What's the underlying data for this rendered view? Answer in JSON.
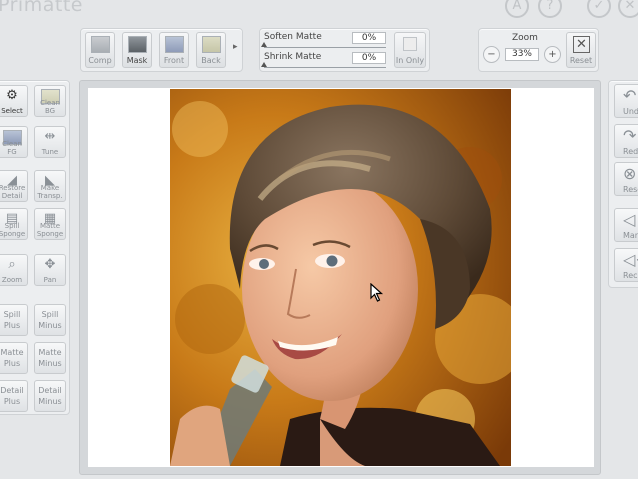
{
  "app": {
    "title": "Primatte",
    "title_buttons": [
      {
        "name": "about",
        "glyph": "A"
      },
      {
        "name": "help",
        "glyph": "?"
      },
      {
        "name": "ok",
        "glyph": "✓"
      },
      {
        "name": "close",
        "glyph": "✕"
      }
    ]
  },
  "view_toolbar": {
    "buttons": [
      {
        "id": "comp",
        "label": "Comp"
      },
      {
        "id": "mask",
        "label": "Mask"
      },
      {
        "id": "front",
        "label": "Front"
      },
      {
        "id": "back",
        "label": "Back"
      }
    ],
    "more_glyph": "▸"
  },
  "matte_controls": {
    "soften_label": "Soften Matte",
    "soften_value": "0%",
    "soften_level": 0.0,
    "shrink_label": "Shrink Matte",
    "shrink_value": "0%",
    "shrink_level": 0.0,
    "in_only_label": "In Only"
  },
  "zoom": {
    "label": "Zoom",
    "minus": "−",
    "value": "33%",
    "plus": "+",
    "reset_label": "Reset"
  },
  "left_tools": [
    {
      "id": "select",
      "label": "Select",
      "icon": "gear-icon",
      "glyph": "⚙",
      "active": true
    },
    {
      "id": "clean-bg",
      "label": "Clean BG",
      "icon": "clean-bg-swatch",
      "glyph": ""
    },
    {
      "id": "clean-fg",
      "label": "Clean FG",
      "icon": "clean-fg-swatch",
      "glyph": ""
    },
    {
      "id": "tune",
      "label": "Tune",
      "icon": "tune-sliders-icon",
      "glyph": "⇹"
    },
    {
      "id": "restore-detail",
      "label": "Restore Detail",
      "icon": "restore-detail-icon",
      "glyph": "◢"
    },
    {
      "id": "make-transp",
      "label": "Make Transp.",
      "icon": "make-transparent-icon",
      "glyph": "◣"
    },
    {
      "id": "spill-sponge",
      "label": "Spill Sponge",
      "icon": "spill-sponge-icon",
      "glyph": "▤"
    },
    {
      "id": "matte-sponge",
      "label": "Matte Sponge",
      "icon": "matte-sponge-icon",
      "glyph": "▦"
    },
    {
      "id": "zoom",
      "label": "Zoom",
      "icon": "magnifier-icon",
      "glyph": "⌕"
    },
    {
      "id": "pan",
      "label": "Pan",
      "icon": "pan-arrows-icon",
      "glyph": "✥"
    },
    {
      "id": "spill-plus",
      "label": "Spill Plus",
      "icon": "",
      "glyph": ""
    },
    {
      "id": "spill-minus",
      "label": "Spill Minus",
      "icon": "",
      "glyph": ""
    },
    {
      "id": "matte-plus",
      "label": "Matte Plus",
      "icon": "",
      "glyph": ""
    },
    {
      "id": "matte-minus",
      "label": "Matte Minus",
      "icon": "",
      "glyph": ""
    },
    {
      "id": "detail-plus",
      "label": "Detail Plus",
      "icon": "",
      "glyph": ""
    },
    {
      "id": "detail-minus",
      "label": "Detail Minus",
      "icon": "",
      "glyph": ""
    }
  ],
  "right_tools": [
    {
      "id": "undo",
      "label": "Undo",
      "glyph": "↶",
      "icon": "undo-icon"
    },
    {
      "id": "redo",
      "label": "Redo",
      "glyph": "↷",
      "icon": "redo-icon"
    },
    {
      "id": "reset",
      "label": "Reset",
      "glyph": "⊗",
      "icon": "reset-icon"
    },
    {
      "id": "mark",
      "label": "Mark",
      "glyph": "◁",
      "icon": "mark-icon"
    },
    {
      "id": "recall",
      "label": "Recall",
      "glyph": "◁+",
      "icon": "recall-icon"
    }
  ],
  "colors": {
    "background": "#e4e6e8",
    "canvas": "#ffffff",
    "photo_backdrop": "#c06a10"
  }
}
